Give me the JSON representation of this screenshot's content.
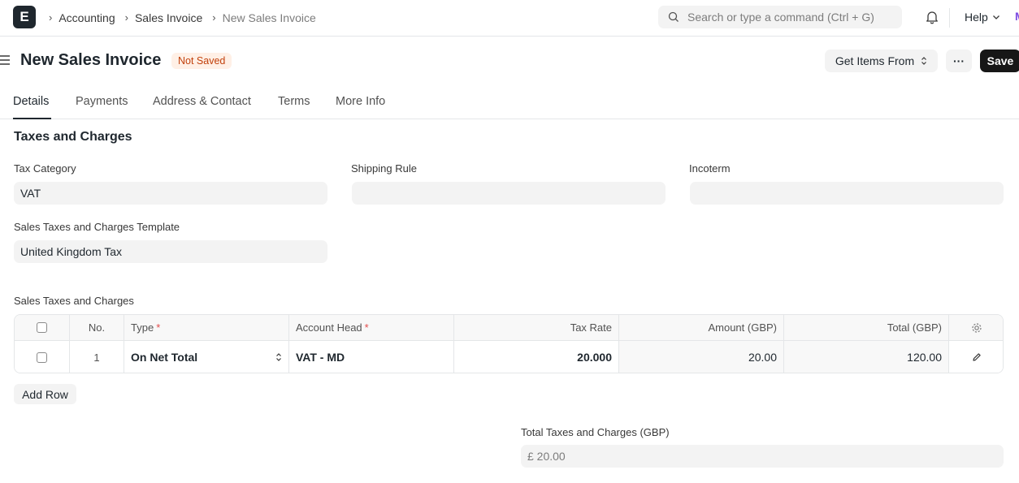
{
  "navbar": {
    "logo": "E",
    "breadcrumbs": [
      "Accounting",
      "Sales Invoice",
      "New Sales Invoice"
    ],
    "search_placeholder": "Search or type a command (Ctrl + G)",
    "help_label": "Help",
    "avatar_peek": "M"
  },
  "header": {
    "title": "New Sales Invoice",
    "status": "Not Saved",
    "get_items_label": "Get Items From",
    "more_label": "···",
    "save_label": "Save"
  },
  "tabs": [
    "Details",
    "Payments",
    "Address & Contact",
    "Terms",
    "More Info"
  ],
  "section": {
    "title": "Taxes and Charges",
    "tax_category": {
      "label": "Tax Category",
      "value": "VAT"
    },
    "shipping_rule": {
      "label": "Shipping Rule",
      "value": ""
    },
    "incoterm": {
      "label": "Incoterm",
      "value": ""
    },
    "template": {
      "label": "Sales Taxes and Charges Template",
      "value": "United Kingdom Tax"
    }
  },
  "grid": {
    "label": "Sales Taxes and Charges",
    "columns": {
      "no": "No.",
      "type": "Type",
      "account_head": "Account Head",
      "tax_rate": "Tax Rate",
      "amount": "Amount (GBP)",
      "total": "Total (GBP)"
    },
    "rows": [
      {
        "no": "1",
        "type": "On Net Total",
        "account_head": "VAT - MD",
        "tax_rate": "20.000",
        "amount": "20.00",
        "total": "120.00"
      }
    ],
    "add_row_label": "Add Row"
  },
  "totals": {
    "label": "Total Taxes and Charges (GBP)",
    "value": "£ 20.00"
  }
}
